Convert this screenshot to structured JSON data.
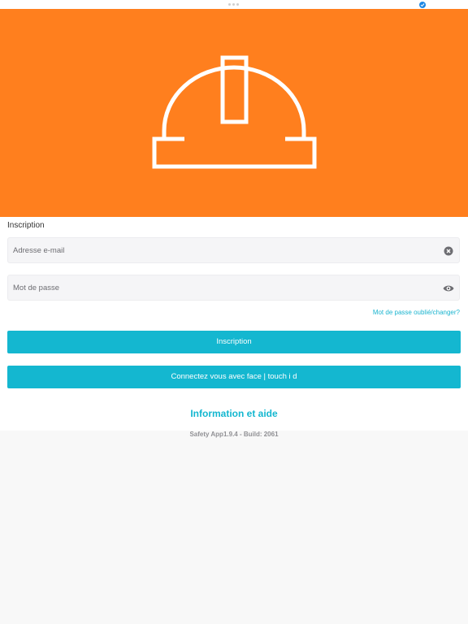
{
  "hero": {
    "icon": "hard-hat-icon",
    "background_color": "#ff7f1e"
  },
  "form": {
    "title": "Inscription",
    "email": {
      "placeholder": "Adresse e-mail",
      "value": "",
      "clear_icon": "clear-circle-icon"
    },
    "password": {
      "placeholder": "Mot de passe",
      "value": "",
      "visibility_icon": "eye-icon"
    },
    "forgot_link": "Mot de passe oublié/changer?",
    "submit_label": "Inscription",
    "biometric_label": "Connectez vous avec face | touch i d",
    "accent_color": "#14b7d0"
  },
  "help": {
    "label": "Information et aide"
  },
  "footer": {
    "version": "Safety App1.9.4 - Build: 2061"
  }
}
